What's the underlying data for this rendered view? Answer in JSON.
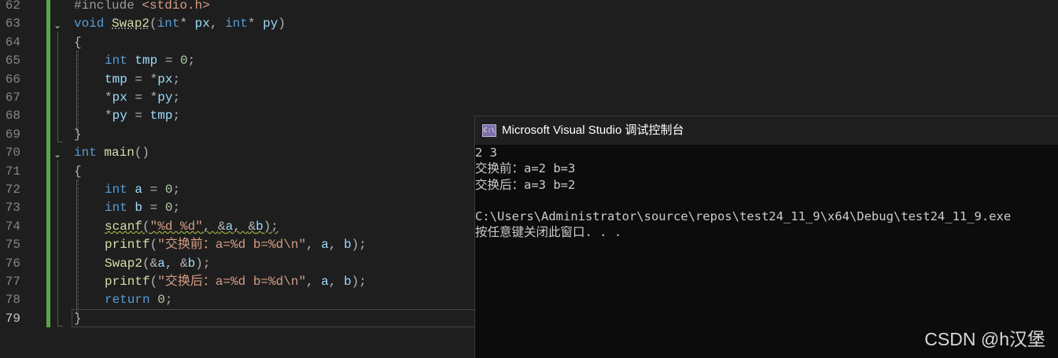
{
  "editor": {
    "line_numbers": [
      "62",
      "63",
      "64",
      "65",
      "66",
      "67",
      "68",
      "69",
      "70",
      "71",
      "72",
      "73",
      "74",
      "75",
      "76",
      "77",
      "78",
      "79"
    ],
    "code": {
      "l62": {
        "a": "#include ",
        "b": "<stdio.h>"
      },
      "l63": {
        "kw": "void",
        "fn": "Swap2",
        "open": "(",
        "t1": "int",
        "star1": "*",
        "p1": " px",
        "comma": ", ",
        "t2": "int",
        "star2": "*",
        "p2": " py",
        "close": ")"
      },
      "l64": "{",
      "l65": {
        "kw": "int",
        "v": "tmp",
        "eq": " = ",
        "n": "0",
        "end": ";"
      },
      "l66": {
        "v": "tmp",
        "eq": " = ",
        "star": "*",
        "p": "px",
        "end": ";"
      },
      "l67": {
        "star1": "*",
        "p1": "px",
        "eq": " = ",
        "star2": "*",
        "p2": "py",
        "end": ";"
      },
      "l68": {
        "star": "*",
        "p": "py",
        "eq": " = ",
        "v": "tmp",
        "end": ";"
      },
      "l69": "}",
      "l70": {
        "kw": "int",
        "fn": "main",
        "paren": "()"
      },
      "l71": "{",
      "l72": {
        "kw": "int",
        "v": "a",
        "eq": " = ",
        "n": "0",
        "end": ";"
      },
      "l73": {
        "kw": "int",
        "v": "b",
        "eq": " = ",
        "n": "0",
        "end": ";"
      },
      "l74": {
        "fn": "scanf",
        "open": "(",
        "str": "\"%d %d\"",
        "comma1": ", ",
        "amp1": "&",
        "a": "a",
        "comma2": ", ",
        "amp2": "&",
        "b": "b",
        "end": ");"
      },
      "l75": {
        "fn": "printf",
        "open": "(",
        "str": "\"交换前：a=%d b=%d\\n\"",
        "comma1": ", ",
        "a": "a",
        "comma2": ", ",
        "b": "b",
        "end": ");"
      },
      "l76": {
        "fn": "Swap2",
        "open": "(",
        "amp1": "&",
        "a": "a",
        "comma": ", ",
        "amp2": "&",
        "b": "b",
        "end": ");"
      },
      "l77": {
        "fn": "printf",
        "open": "(",
        "str": "\"交换后：a=%d b=%d\\n\"",
        "comma1": ", ",
        "a": "a",
        "comma2": ", ",
        "b": "b",
        "end": ");"
      },
      "l78": {
        "kw": "return",
        "sp": " ",
        "n": "0",
        "end": ";"
      },
      "l79": "}"
    }
  },
  "console": {
    "title": "Microsoft Visual Studio 调试控制台",
    "icon_text": "C:\\",
    "lines": [
      "2 3",
      "交换前：a=2 b=3",
      "交换后：a=3 b=2",
      "",
      "C:\\Users\\Administrator\\source\\repos\\test24_11_9\\x64\\Debug\\test24_11_9.exe",
      "按任意键关闭此窗口. . ."
    ]
  },
  "watermark": "CSDN @h汉堡",
  "colors": {
    "editor_bg": "#1e1e1e",
    "keyword": "#569cd6",
    "function": "#dcdcaa",
    "variable": "#9cdcfe",
    "number": "#b5cea8",
    "string": "#d69d85",
    "change_bar": "#57a64a",
    "console_bg": "#0c0c0c"
  }
}
